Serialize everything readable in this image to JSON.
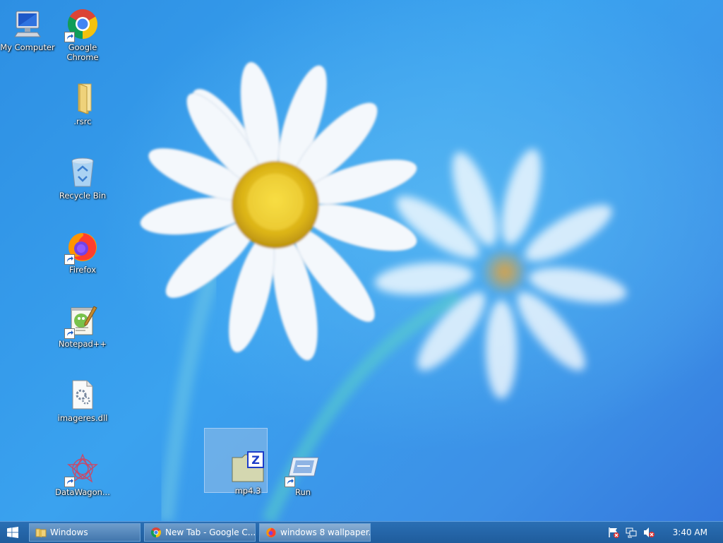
{
  "desktop_icons": [
    {
      "label": "My Computer",
      "icon": "computer-icon",
      "shortcut": false
    },
    {
      "label": "Google Chrome",
      "icon": "chrome-icon",
      "shortcut": true
    },
    {
      "label": ".rsrc",
      "icon": "folder-icon",
      "shortcut": false
    },
    {
      "label": "Recycle Bin",
      "icon": "recycle-bin-icon",
      "shortcut": false
    },
    {
      "label": "Firefox",
      "icon": "firefox-icon",
      "shortcut": true
    },
    {
      "label": "Notepad++",
      "icon": "notepad-plus-plus-icon",
      "shortcut": true
    },
    {
      "label": "imageres.dll",
      "icon": "dll-file-icon",
      "shortcut": false
    },
    {
      "label": "DataWagon...",
      "icon": "datawagon-icon",
      "shortcut": true
    },
    {
      "label": "mp4.3",
      "icon": "zip-archive-icon",
      "shortcut": false
    },
    {
      "label": "Run",
      "icon": "run-icon",
      "shortcut": true
    }
  ],
  "taskbar": {
    "tasks": [
      {
        "label": "Windows",
        "icon": "folder-icon"
      },
      {
        "label": "New Tab - Google C...",
        "icon": "chrome-icon"
      },
      {
        "label": "windows 8 wallpaper...",
        "icon": "firefox-icon"
      }
    ],
    "tray_icons": [
      "action-center-flag-icon",
      "network-icon",
      "volume-muted-icon"
    ],
    "clock": "3:40 AM"
  },
  "colors": {
    "desktop_bg": "#3a9ded",
    "taskbar_bg": "#2566a8",
    "flower_center": "#e8c21e"
  }
}
